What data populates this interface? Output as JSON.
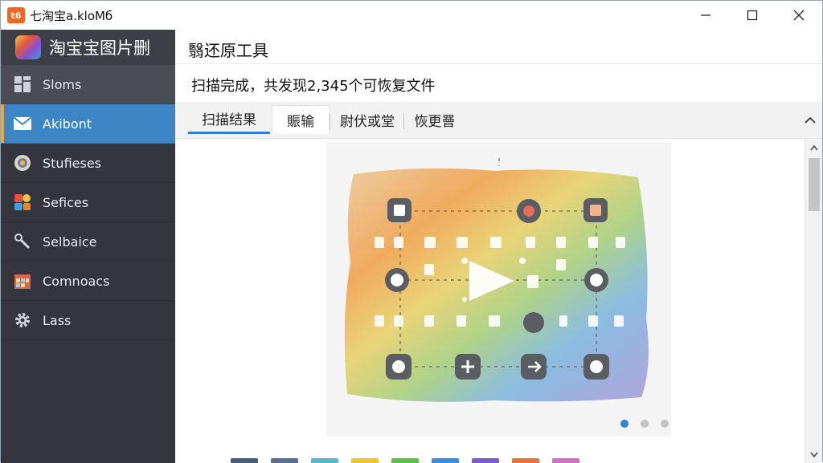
{
  "window": {
    "title": "七淘宝a.kloMб",
    "app_icon_text": "t6",
    "controls": {
      "minimize_icon": "minimize-icon",
      "maximize_icon": "maximize-icon",
      "close_icon": "close-icon"
    }
  },
  "sidebar": {
    "app_name": "淘宝宝图片删",
    "items": [
      {
        "label": "Sloms",
        "icon": "grid-icon"
      },
      {
        "label": "Akibont",
        "icon": "mail-icon",
        "active": true
      },
      {
        "label": "Stufieses",
        "icon": "camera-icon"
      },
      {
        "label": "Sefices",
        "icon": "apps-icon"
      },
      {
        "label": "Selbaice",
        "icon": "tools-icon"
      },
      {
        "label": "Comnoacs",
        "icon": "calendar-icon"
      },
      {
        "label": "Lass",
        "icon": "gear-icon"
      }
    ]
  },
  "main": {
    "page_title": "翳还原工具",
    "status_text": "扫描完成，共发现2,345个可恢复文件",
    "tabs": [
      {
        "label": "扫描结果",
        "active": true
      },
      {
        "label": "賑输"
      },
      {
        "label": "尉伏或堂"
      },
      {
        "label": "恢更罾"
      }
    ],
    "carousel": {
      "page_count": 3,
      "current_page": 1
    }
  },
  "colors": {
    "sidebar_bg": "#33373d",
    "active_blue": "#3d86c6",
    "active_marker": "#e8a83a",
    "dot_active": "#2f86d8"
  }
}
